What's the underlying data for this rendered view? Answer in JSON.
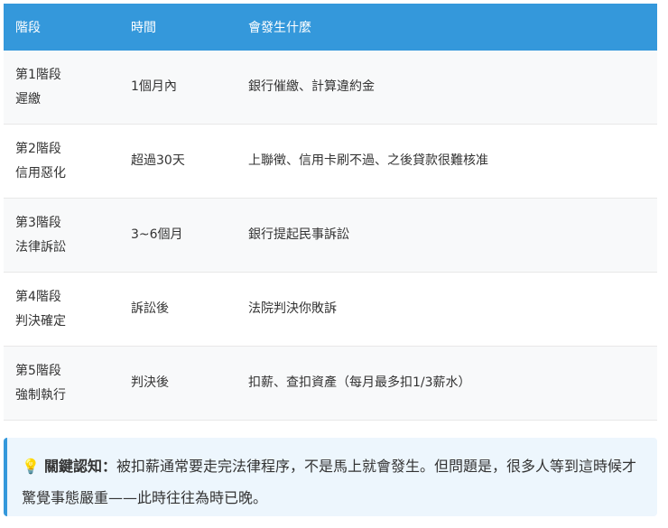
{
  "table": {
    "headers": [
      "階段",
      "時間",
      "會發生什麼"
    ],
    "rows": [
      {
        "stage": "第1階段",
        "name": "遲繳",
        "time": "1個月內",
        "what": "銀行催繳、計算違約金"
      },
      {
        "stage": "第2階段",
        "name": "信用惡化",
        "time": "超過30天",
        "what": "上聯徵、信用卡刷不過、之後貸款很難核准"
      },
      {
        "stage": "第3階段",
        "name": "法律訴訟",
        "time": "3~6個月",
        "what": "銀行提起民事訴訟"
      },
      {
        "stage": "第4階段",
        "name": "判決確定",
        "time": "訴訟後",
        "what": "法院判決你敗訴"
      },
      {
        "stage": "第5階段",
        "name": "強制執行",
        "time": "判決後",
        "what": "扣薪、查扣資產（每月最多扣1/3薪水）"
      }
    ]
  },
  "callout": {
    "icon": "lightbulb-icon",
    "label": "關鍵認知：",
    "text": "被扣薪通常要走完法律程序，不是馬上就會發生。但問題是，很多人等到這時候才驚覺事態嚴重——此時往往為時已晚。"
  },
  "colors": {
    "header": "#3498db",
    "callout_bg": "#edf6fd"
  }
}
